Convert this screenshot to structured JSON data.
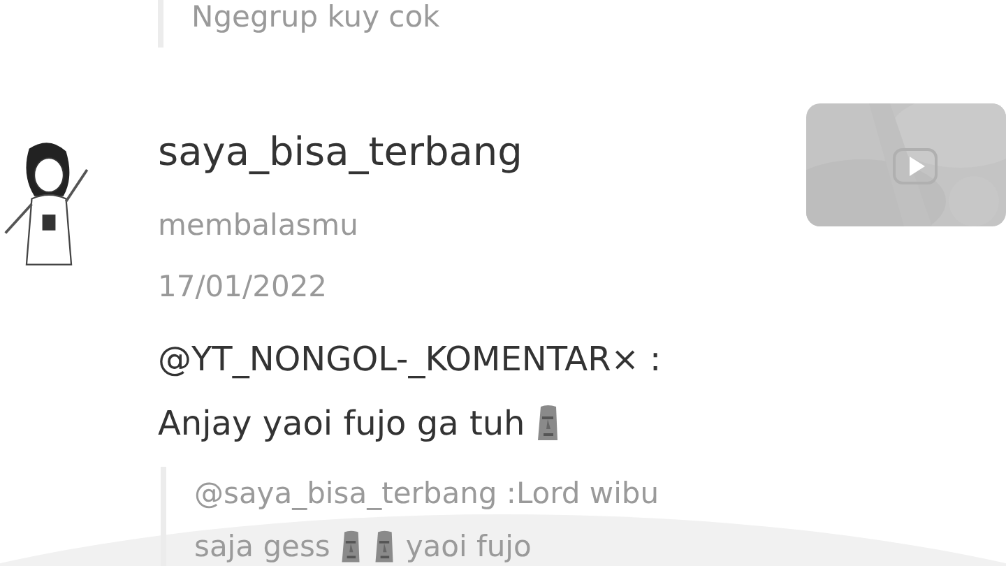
{
  "previous_reply": {
    "quote": "Ngegrup kuy cok"
  },
  "notification": {
    "username": "saya_bisa_terbang",
    "action": "membalasmu",
    "date": "17/01/2022",
    "comment_lines": [
      [
        {
          "kind": "text",
          "text": "@YT_NONGOL-_KOMENTAR× :"
        }
      ],
      [
        {
          "kind": "text",
          "text": "Anjay yaoi fujo ga tuh"
        },
        {
          "kind": "moai"
        }
      ]
    ],
    "quote_lines": [
      [
        {
          "kind": "text",
          "text": "@saya_bisa_terbang :Lord wibu"
        }
      ],
      [
        {
          "kind": "text",
          "text": "saja gess"
        },
        {
          "kind": "moai"
        },
        {
          "kind": "moai"
        },
        {
          "kind": "text",
          "text": "yaoi fujo"
        }
      ]
    ],
    "thumbnail": {
      "kind": "picture"
    }
  }
}
